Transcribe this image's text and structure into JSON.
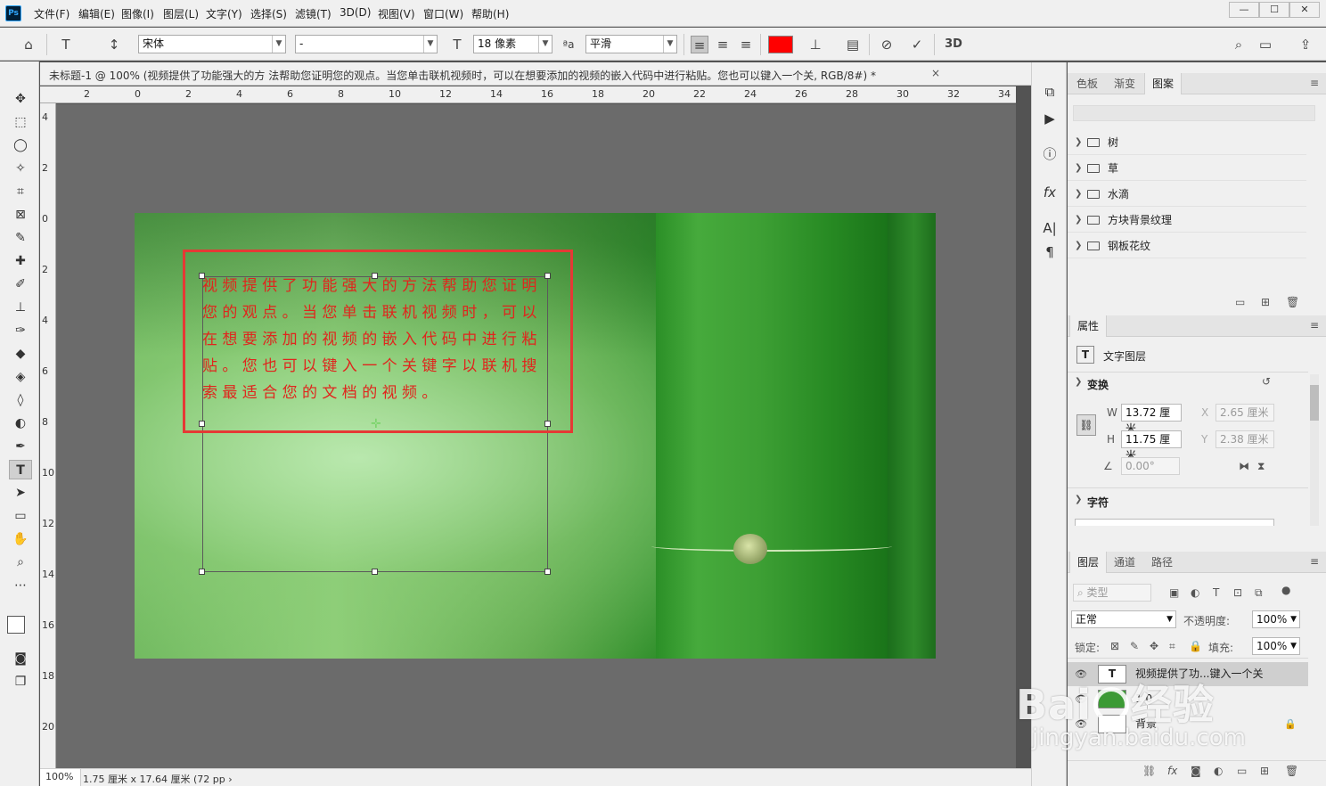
{
  "menu": [
    "文件(F)",
    "编辑(E)",
    "图像(I)",
    "图层(L)",
    "文字(Y)",
    "选择(S)",
    "滤镜(T)",
    "3D(D)",
    "视图(V)",
    "窗口(W)",
    "帮助(H)"
  ],
  "app_logo": "Ps",
  "window_controls": {
    "minimize": "—",
    "maximize": "☐",
    "close": "✕"
  },
  "options": {
    "font_family": "宋体",
    "font_style": "-",
    "font_size": "18 像素",
    "aa_label": "ªa",
    "anti_alias": "平滑",
    "text_color": "#ff0000",
    "threed": "3D"
  },
  "document": {
    "tab_title": "未标题-1 @ 100% (视频提供了功能强大的方 法帮助您证明您的观点。当您单击联机视频时，可以在想要添加的视频的嵌入代码中进行粘贴。您也可以键入一个关, RGB/8#) *",
    "tab_close": "×",
    "paragraph": "视频提供了功能强大的方法帮助您证明您的观点。当您单击联机视频时，可以在想要添加的视频的嵌入代码中进行粘贴。您也可以键入一个关键字以联机搜索最适合您的文档的视频。"
  },
  "ruler_top": [
    "2",
    "0",
    "2",
    "4",
    "6",
    "8",
    "10",
    "12",
    "14",
    "16",
    "18",
    "20",
    "22",
    "24",
    "26",
    "28",
    "30",
    "32",
    "34"
  ],
  "ruler_left": [
    "4",
    "2",
    "0",
    "2",
    "4",
    "6",
    "8",
    "10",
    "12",
    "14",
    "16",
    "18",
    "20"
  ],
  "status": {
    "zoom": "100%",
    "doc_size": "1.75 厘米 x 17.64 厘米 (72 pp ›"
  },
  "patterns_panel": {
    "tabs": [
      "色板",
      "渐变",
      "图案"
    ],
    "active_tab": "图案",
    "groups": [
      "树",
      "草",
      "水滴",
      "方块背景纹理",
      "钢板花纹"
    ]
  },
  "properties_panel": {
    "tab": "属性",
    "layer_type": "文字图层",
    "transform_label": "变换",
    "w_label": "W",
    "w": "13.72 厘米",
    "h_label": "H",
    "h": "11.75 厘米",
    "x_label": "X",
    "x": "2.65 厘米",
    "y_label": "Y",
    "y": "2.38 厘米",
    "angle": "0.00°",
    "character_label": "字符"
  },
  "layers_panel": {
    "tabs": [
      "图层",
      "通道",
      "路径"
    ],
    "kind_filter": "类型",
    "blend_mode": "正常",
    "opacity_label": "不透明度:",
    "opacity": "100%",
    "lock_label": "锁定:",
    "fill_label": "填充:",
    "fill": "100%",
    "layers": [
      {
        "name": "视频提供了功...键入一个关"
      },
      {
        "name": "1 0"
      },
      {
        "name": "背景"
      }
    ]
  },
  "watermark": {
    "logo": "Bai经验",
    "logo_left": "Bai",
    "logo_right": "经验",
    "domain": "jingyan.baidu.com"
  }
}
